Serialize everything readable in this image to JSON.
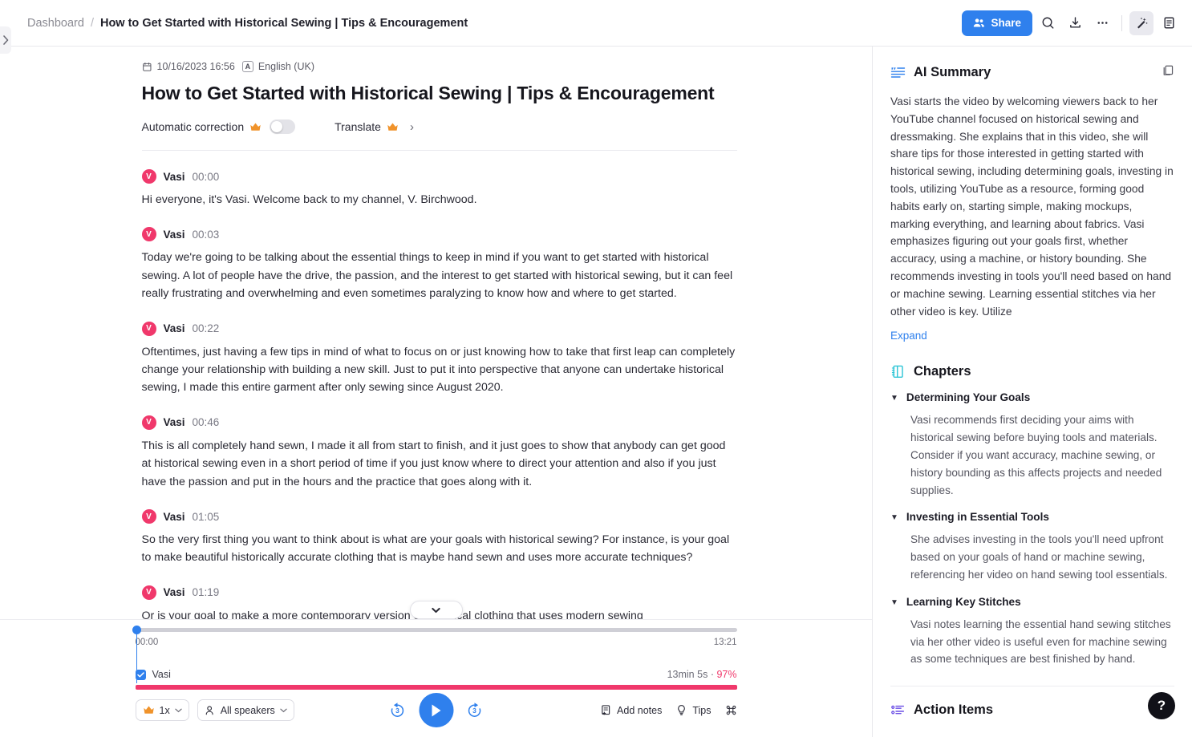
{
  "breadcrumb": {
    "root": "Dashboard",
    "separator": "/",
    "current": "How to Get Started with Historical Sewing | Tips & Encouragement"
  },
  "toolbar": {
    "share_label": "Share",
    "icons": [
      "people-icon",
      "search-icon",
      "download-icon",
      "more-icon",
      "magic-wand-icon",
      "notes-icon"
    ]
  },
  "document": {
    "date": "10/16/2023 16:56",
    "language_badge": "A",
    "language": "English (UK)",
    "title": "How to Get Started with Historical Sewing | Tips & Encouragement",
    "auto_correction_label": "Automatic correction",
    "auto_correction_on": false,
    "translate_label": "Translate"
  },
  "transcript": [
    {
      "avatar": "V",
      "speaker": "Vasi",
      "time": "00:00",
      "text": "Hi everyone, it's Vasi. Welcome back to my channel, V. Birchwood."
    },
    {
      "avatar": "V",
      "speaker": "Vasi",
      "time": "00:03",
      "text": "Today we're going to be talking about the essential things to keep in mind if you want to get started with historical sewing. A lot of people have the drive, the passion, and the interest to get started with historical sewing, but it can feel really frustrating and overwhelming and even sometimes paralyzing to know how and where to get started."
    },
    {
      "avatar": "V",
      "speaker": "Vasi",
      "time": "00:22",
      "text": "Oftentimes, just having a few tips in mind of what to focus on or just knowing how to take that first leap can completely change your relationship with building a new skill. Just to put it into perspective that anyone can undertake historical sewing, I made this entire garment after only sewing since August 2020."
    },
    {
      "avatar": "V",
      "speaker": "Vasi",
      "time": "00:46",
      "text": "This is all completely hand sewn, I made it all from start to finish, and it just goes to show that anybody can get good at historical sewing even in a short period of time if you just know where to direct your attention and also if you just have the passion and put in the hours and the practice that goes along with it."
    },
    {
      "avatar": "V",
      "speaker": "Vasi",
      "time": "01:05",
      "text": "So the very first thing you want to think about is what are your goals with historical sewing? For instance, is your goal to make beautiful historically accurate clothing that is maybe hand sewn and uses more accurate techniques?"
    },
    {
      "avatar": "V",
      "speaker": "Vasi",
      "time": "01:19",
      "text": "Or is your goal to make a more contemporary version of historical clothing that uses modern sewing"
    }
  ],
  "player": {
    "current_time": "00:00",
    "total_time": "13:21",
    "speaker_track_label": "Vasi",
    "speaker_track_duration": "13min 5s",
    "speaker_track_separator": "·",
    "speaker_track_confidence": "97%",
    "speed_label": "1x",
    "speakers_label": "All speakers",
    "skip_back_label": "3",
    "skip_forward_label": "3",
    "add_notes_label": "Add notes",
    "tips_label": "Tips",
    "shortcut_icon": "command-icon"
  },
  "right_panel": {
    "summary": {
      "title": "AI Summary",
      "text": "Vasi starts the video by welcoming viewers back to her YouTube channel focused on historical sewing and dressmaking. She explains that in this video, she will share tips for those interested in getting started with historical sewing, including determining goals, investing in tools, utilizing YouTube as a resource, forming good habits early on, starting simple, making mockups, marking everything, and learning about fabrics. Vasi emphasizes figuring out your goals first, whether accuracy, using a machine, or history bounding. She recommends investing in tools you'll need based on hand or machine sewing. Learning essential stitches via her other video is key. Utilize",
      "expand_label": "Expand"
    },
    "chapters": {
      "title": "Chapters",
      "items": [
        {
          "title": "Determining Your Goals",
          "body": "Vasi recommends first deciding your aims with historical sewing before buying tools and materials. Consider if you want accuracy, machine sewing, or history bounding as this affects projects and needed supplies."
        },
        {
          "title": "Investing in Essential Tools",
          "body": "She advises investing in the tools you'll need upfront based on your goals of hand or machine sewing, referencing her video on hand sewing tool essentials."
        },
        {
          "title": "Learning Key Stitches",
          "body": "Vasi notes learning the essential hand sewing stitches via her other video is useful even for machine sewing as some techniques are best finished by hand."
        }
      ]
    },
    "action_items": {
      "title": "Action Items"
    },
    "help_label": "?"
  },
  "colors": {
    "accent_blue": "#2f80ed",
    "speaker_pink": "#f0386b",
    "chapters_teal": "#2ec5d6",
    "action_purple": "#6b4ee6",
    "crown_orange": "#f0932b"
  }
}
